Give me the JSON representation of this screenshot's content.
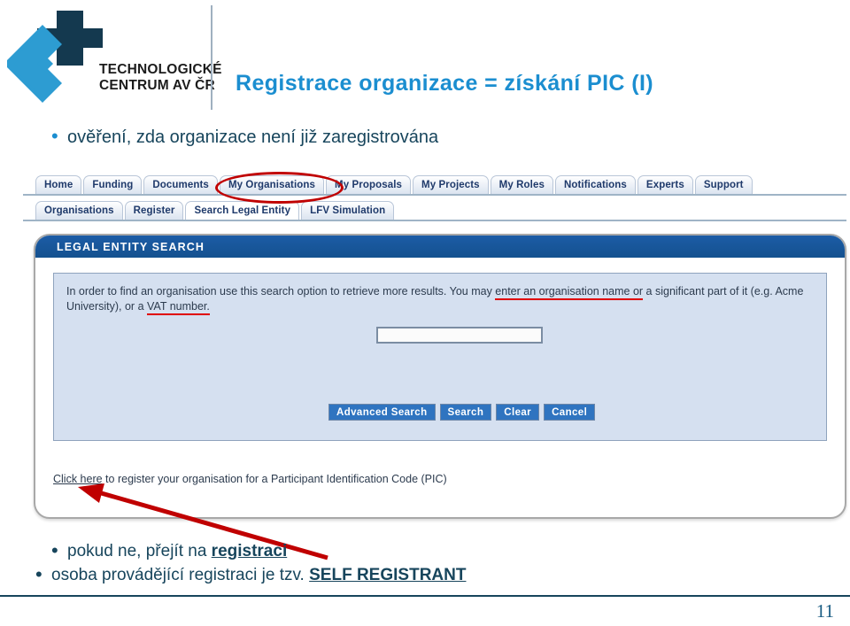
{
  "brand": {
    "logo_icon": "tc-av-cr-logo-icon",
    "logo_line1": "TECHNOLOGICKÉ",
    "logo_line2": "CENTRUM AV ČR",
    "accent_blue": "#1b8ed0",
    "dark_navy": "#17455c"
  },
  "slide": {
    "title": "Registrace organizace = získání PIC (I)",
    "top_bullet": "ověření, zda organizace není již zaregistrována",
    "bottom_bullets": [
      {
        "prefix": "pokud ne, přejít na ",
        "emphasis": "registraci",
        "suffix": ""
      },
      {
        "prefix": "osoba provádějící registraci je tzv. ",
        "emphasis": "SELF REGISTRANT",
        "suffix": ""
      }
    ],
    "page_number": "11"
  },
  "portal": {
    "primary_tabs": [
      {
        "label": "Home",
        "active": false
      },
      {
        "label": "Funding",
        "active": false
      },
      {
        "label": "Documents",
        "active": false
      },
      {
        "label": "My Organisations",
        "active": false,
        "highlighted": true
      },
      {
        "label": "My Proposals",
        "active": false
      },
      {
        "label": "My Projects",
        "active": false
      },
      {
        "label": "My Roles",
        "active": false
      },
      {
        "label": "Notifications",
        "active": false
      },
      {
        "label": "Experts",
        "active": false
      },
      {
        "label": "Support",
        "active": false
      }
    ],
    "secondary_tabs": [
      {
        "label": "Organisations",
        "active": false
      },
      {
        "label": "Register",
        "active": false
      },
      {
        "label": "Search Legal Entity",
        "active": true
      },
      {
        "label": "LFV Simulation",
        "active": false
      }
    ],
    "panel": {
      "header": "LEGAL ENTITY SEARCH",
      "description_part1": "In order to find an organisation use this search option to retrieve more results. You may ",
      "description_underline1": "enter an organisation name or",
      "description_part2": " a significant part of it (e.g. Acme University), or a ",
      "description_underline2": "VAT number.",
      "search_value": "",
      "search_placeholder": "",
      "buttons": [
        "Advanced Search",
        "Search",
        "Clear",
        "Cancel"
      ],
      "footnote_link": "Click here",
      "footnote_text": " to register your organisation for a Participant Identification Code (PIC)"
    }
  },
  "annotations": {
    "ellipse_target": "My Organisations",
    "arrow_target": "Click here",
    "annotation_color": "#c00000"
  }
}
